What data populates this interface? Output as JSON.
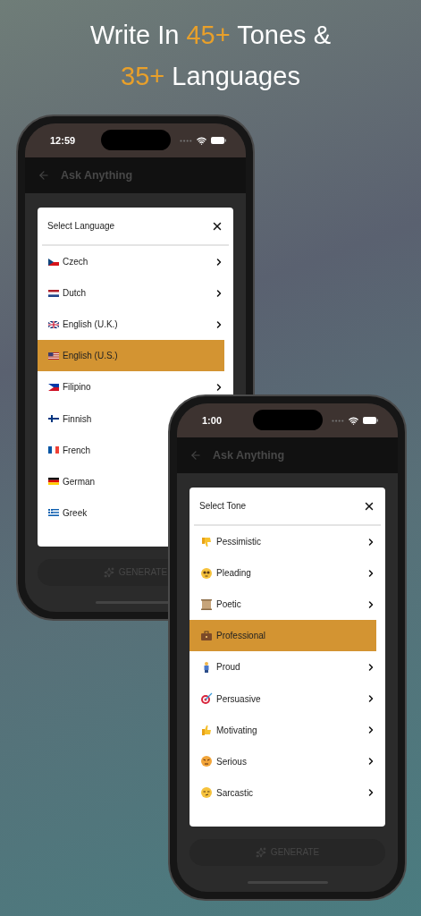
{
  "headline": {
    "lines": [
      [
        {
          "text": "Write In ",
          "highlight": false
        },
        {
          "text": "45+",
          "highlight": true
        },
        {
          "text": " Tones &",
          "highlight": false
        }
      ],
      [
        {
          "text": "35+",
          "highlight": true
        },
        {
          "text": " Languages",
          "highlight": false
        }
      ]
    ]
  },
  "phones": [
    {
      "time": "12:59",
      "title": "Ask Anything",
      "modal": {
        "title": "Select Language",
        "items": [
          {
            "label": "Czech",
            "selected": false,
            "arrow": true
          },
          {
            "label": "Dutch",
            "selected": false,
            "arrow": true
          },
          {
            "label": "English (U.K.)",
            "selected": false,
            "arrow": true
          },
          {
            "label": "English (U.S.)",
            "selected": true,
            "arrow": false
          },
          {
            "label": "Filipino",
            "selected": false,
            "arrow": true
          },
          {
            "label": "Finnish",
            "selected": false,
            "arrow": false
          },
          {
            "label": "French",
            "selected": false,
            "arrow": false
          },
          {
            "label": "German",
            "selected": false,
            "arrow": false
          },
          {
            "label": "Greek",
            "selected": false,
            "arrow": false
          }
        ]
      },
      "button": "GENERATE"
    },
    {
      "time": "1:00",
      "title": "Ask Anything",
      "modal": {
        "title": "Select Tone",
        "items": [
          {
            "label": "Pessimistic",
            "selected": false,
            "arrow": true
          },
          {
            "label": "Pleading",
            "selected": false,
            "arrow": true
          },
          {
            "label": "Poetic",
            "selected": false,
            "arrow": true
          },
          {
            "label": "Professional",
            "selected": true,
            "arrow": false
          },
          {
            "label": "Proud",
            "selected": false,
            "arrow": true
          },
          {
            "label": "Persuasive",
            "selected": false,
            "arrow": true
          },
          {
            "label": "Motivating",
            "selected": false,
            "arrow": true
          },
          {
            "label": "Serious",
            "selected": false,
            "arrow": true
          },
          {
            "label": "Sarcastic",
            "selected": false,
            "arrow": true
          }
        ]
      },
      "button": "GENERATE"
    }
  ]
}
